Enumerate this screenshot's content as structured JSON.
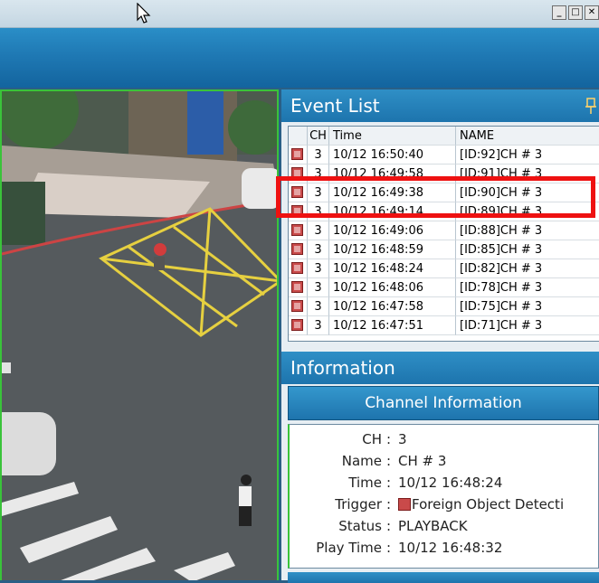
{
  "window": {
    "controls": [
      "_",
      "□",
      "✕"
    ]
  },
  "event_list": {
    "title": "Event List",
    "columns": [
      "",
      "CH",
      "Time",
      "NAME"
    ],
    "rows": [
      {
        "ch": "3",
        "time": "10/12 16:50:40",
        "name": "[ID:92]CH # 3"
      },
      {
        "ch": "3",
        "time": "10/12 16:49:58",
        "name": "[ID:91]CH # 3"
      },
      {
        "ch": "3",
        "time": "10/12 16:49:38",
        "name": "[ID:90]CH # 3"
      },
      {
        "ch": "3",
        "time": "10/12 16:49:14",
        "name": "[ID:89]CH # 3"
      },
      {
        "ch": "3",
        "time": "10/12 16:49:06",
        "name": "[ID:88]CH # 3"
      },
      {
        "ch": "3",
        "time": "10/12 16:48:59",
        "name": "[ID:85]CH # 3"
      },
      {
        "ch": "3",
        "time": "10/12 16:48:24",
        "name": "[ID:82]CH # 3"
      },
      {
        "ch": "3",
        "time": "10/12 16:48:06",
        "name": "[ID:78]CH # 3"
      },
      {
        "ch": "3",
        "time": "10/12 16:47:58",
        "name": "[ID:75]CH # 3"
      },
      {
        "ch": "3",
        "time": "10/12 16:47:51",
        "name": "[ID:71]CH # 3"
      }
    ],
    "highlight_color": "#ee1111"
  },
  "information": {
    "title": "Information",
    "channel_button": "Channel Information",
    "fields": [
      {
        "label": "CH",
        "value": "3"
      },
      {
        "label": "Name",
        "value": "CH # 3"
      },
      {
        "label": "Time",
        "value": "10/12 16:48:24"
      },
      {
        "label": "Trigger",
        "value": "Foreign Object Detecti"
      },
      {
        "label": "Status",
        "value": "PLAYBACK"
      },
      {
        "label": "Play Time",
        "value": "10/12 16:48:32"
      }
    ]
  },
  "colors": {
    "accent_blue": "#1f79b4",
    "camera_border": "#3ac33a",
    "event_icon": "#c94a4a"
  }
}
